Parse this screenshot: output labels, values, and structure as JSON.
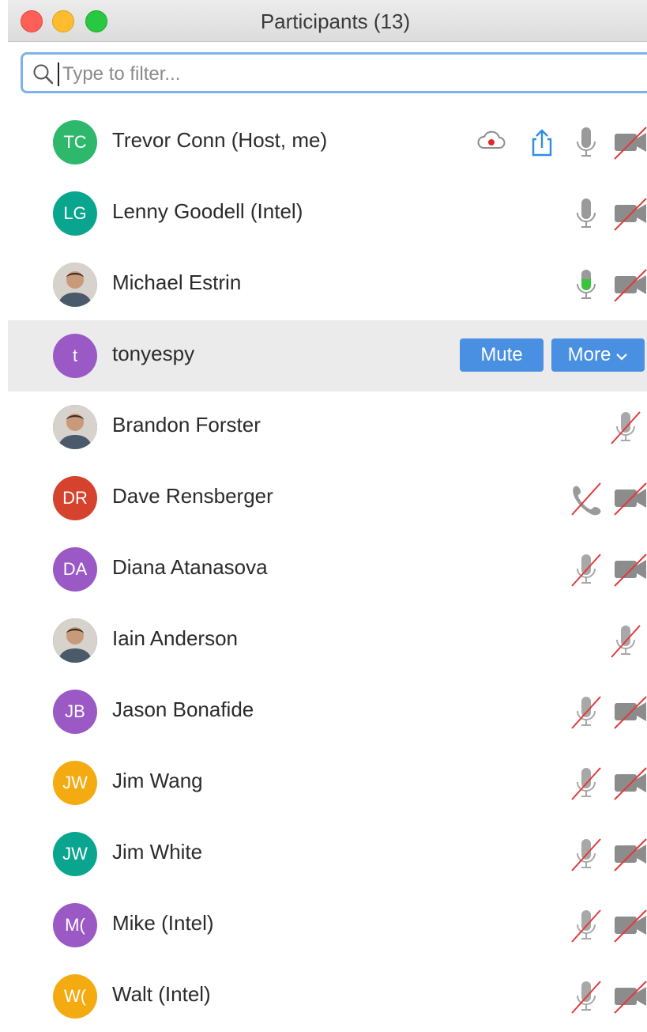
{
  "window": {
    "title": "Participants (13)"
  },
  "filter": {
    "placeholder": "Type to filter...",
    "value": ""
  },
  "participants": [
    {
      "name": "Trevor Conn (Host, me)",
      "initials": "TC",
      "avatar_color": "#2db86b",
      "icons": [
        "cloud-record-icon",
        "share-screen-icon",
        "mic-on-icon",
        "video-off-icon"
      ]
    },
    {
      "name": "Lenny Goodell (Intel)",
      "initials": "LG",
      "avatar_color": "#0aa58f",
      "icons": [
        "mic-on-icon",
        "video-off-icon"
      ]
    },
    {
      "name": "Michael Estrin",
      "initials": "",
      "avatar_color": "#c9a48a",
      "icons": [
        "mic-active-icon",
        "video-off-icon"
      ]
    },
    {
      "name": "tonyespy",
      "initials": "t",
      "avatar_color": "#9b59c6",
      "icons": []
    },
    {
      "name": "Brandon Forster",
      "initials": "",
      "avatar_color": "#8a7a6a",
      "icons": [
        "mic-muted-icon"
      ]
    },
    {
      "name": "Dave Rensberger",
      "initials": "DR",
      "avatar_color": "#d5432e",
      "icons": [
        "phone-muted-icon",
        "video-off-icon"
      ]
    },
    {
      "name": "Diana Atanasova",
      "initials": "DA",
      "avatar_color": "#9b59c6",
      "icons": [
        "mic-muted-icon",
        "video-off-icon"
      ]
    },
    {
      "name": "Iain Anderson",
      "initials": "",
      "avatar_color": "#3a3a3a",
      "icons": [
        "mic-muted-icon"
      ]
    },
    {
      "name": "Jason Bonafide",
      "initials": "JB",
      "avatar_color": "#9b59c6",
      "icons": [
        "mic-muted-icon",
        "video-off-icon"
      ]
    },
    {
      "name": "Jim Wang",
      "initials": "JW",
      "avatar_color": "#f4ab12",
      "icons": [
        "mic-muted-icon",
        "video-off-icon"
      ]
    },
    {
      "name": "Jim White",
      "initials": "JW",
      "avatar_color": "#0aa58f",
      "icons": [
        "mic-muted-icon",
        "video-off-icon"
      ]
    },
    {
      "name": "Mike (Intel)",
      "initials": "M(",
      "avatar_color": "#9b59c6",
      "icons": [
        "mic-muted-icon",
        "video-off-icon"
      ]
    },
    {
      "name": "Walt (Intel)",
      "initials": "W(",
      "avatar_color": "#f4ab12",
      "icons": [
        "mic-muted-icon",
        "video-off-icon"
      ]
    }
  ],
  "selected_row": {
    "mute_label": "Mute",
    "more_label": "More",
    "button_color": "#4a90e2"
  },
  "colors": {
    "muted_slash": "#e03a3a",
    "mic_active": "#3cc43c",
    "icon_gray": "#8c8c8c"
  }
}
